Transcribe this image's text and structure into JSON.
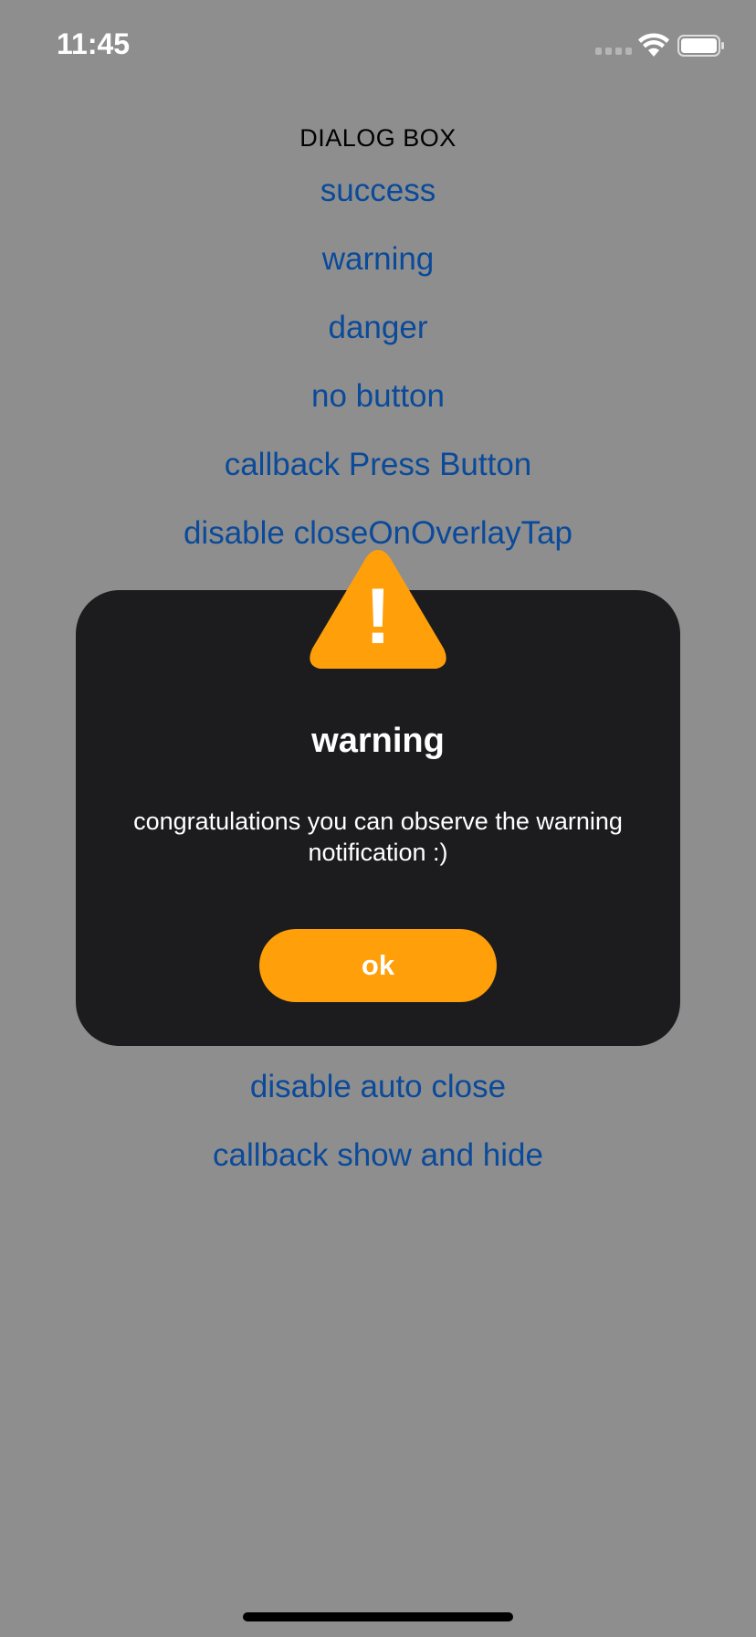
{
  "status_bar": {
    "time": "11:45"
  },
  "menu": {
    "title": "DIALOG BOX",
    "items": [
      "success",
      "warning",
      "danger",
      "no button",
      "callback Press Button",
      "disable closeOnOverlayTap",
      "disable auto close",
      "callback show and hide"
    ]
  },
  "dialog": {
    "icon": "warning-triangle-icon",
    "icon_text": "!",
    "title": "warning",
    "message": "congratulations you can observe the warning notification :)",
    "button_label": "ok"
  },
  "colors": {
    "background": "#8e8e8e",
    "link": "#0a4a9a",
    "dialog_bg": "#1c1c1e",
    "accent": "#ff9f0a"
  }
}
